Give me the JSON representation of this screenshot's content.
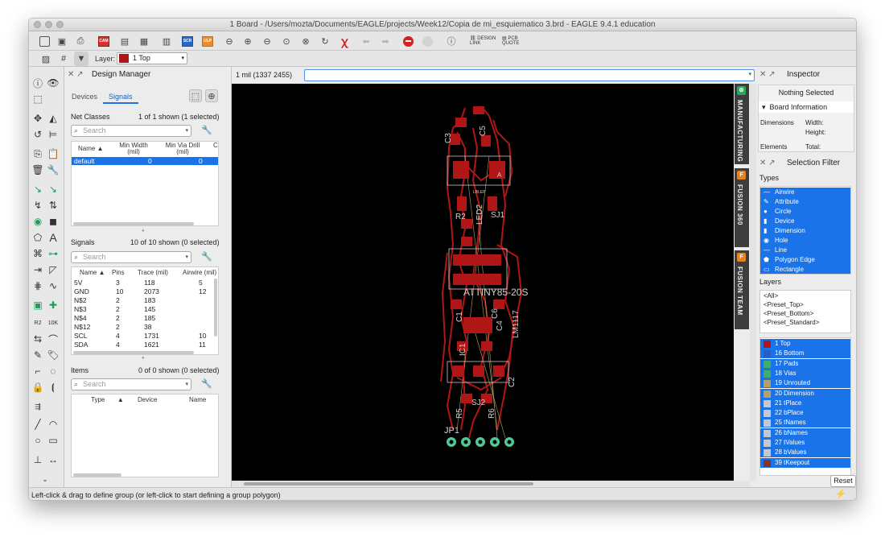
{
  "window": {
    "title": "1 Board - /Users/mozta/Documents/EAGLE/projects/Week12/Copia de mi_esquiematico 3.brd - EAGLE 9.4.1 education"
  },
  "toolbar": {
    "scr_label": "SCR",
    "ulp_label": "ULP",
    "design_link": "DESIGN LINK",
    "pcb_quote": "PCB QUOTE",
    "icons": [
      "new-file-icon",
      "save-icon",
      "print-icon",
      "cam-icon",
      "board-icon",
      "schematic-icon",
      "library-icon",
      "script-icon",
      "ulp-icon",
      "zoom-fit-icon",
      "zoom-in-icon",
      "zoom-out-icon",
      "zoom-select-icon",
      "zoom-area-icon",
      "redraw-icon",
      "ripup-icon",
      "undo-icon",
      "redo-icon",
      "stop-icon",
      "go-icon",
      "help-icon"
    ]
  },
  "layerbar": {
    "label": "Layer:",
    "selected": "1 Top",
    "selected_color": "#b11616"
  },
  "design_manager": {
    "title": "Design Manager",
    "tabs": [
      "Devices",
      "Signals"
    ],
    "active_tab": "Signals",
    "net_classes": {
      "title": "Net Classes",
      "count": "1 of 1 shown (1 selected)",
      "search_placeholder": "Search",
      "headers": [
        "Name",
        "Min Width\n(mil)",
        "Min Via Drill\n(mil)",
        "Cl"
      ],
      "rows": [
        [
          "default",
          "0",
          "0"
        ]
      ]
    },
    "signals": {
      "title": "Signals",
      "count": "10 of 10 shown (0 selected)",
      "search_placeholder": "Search",
      "headers": [
        "Name",
        "Pins",
        "Trace (mil)",
        "Airwire (mil)"
      ],
      "rows": [
        [
          "5V",
          "3",
          "118",
          "5"
        ],
        [
          "GND",
          "10",
          "2073",
          "12"
        ],
        [
          "N$2",
          "2",
          "183",
          ""
        ],
        [
          "N$3",
          "2",
          "145",
          ""
        ],
        [
          "N$4",
          "2",
          "185",
          ""
        ],
        [
          "N$12",
          "2",
          "38",
          ""
        ],
        [
          "SCL",
          "4",
          "1731",
          "10"
        ],
        [
          "SDA",
          "4",
          "1621",
          "11"
        ]
      ]
    },
    "items": {
      "title": "Items",
      "count": "0 of 0 shown (0 selected)",
      "search_placeholder": "Search",
      "headers": [
        "Type",
        "Device",
        "Name"
      ]
    }
  },
  "command": {
    "coordinates": "1 mil (1337 2455)",
    "value": ""
  },
  "side_tabs": [
    "MANUFACTURING",
    "FUSION 360",
    "FUSION TEAM"
  ],
  "board": {
    "labels": [
      "C3",
      "C5",
      "R2",
      "LED2",
      "SJ1",
      "ATTINY85-20S",
      "C1",
      "C6",
      "C4",
      "IC1",
      "LM1117",
      "C2",
      "SJ2",
      "R5",
      "R6",
      "JP1",
      "A",
      "LBLEP"
    ],
    "colors": {
      "background": "#000000",
      "copper_top": "#b11616",
      "pads": "#4fc896",
      "text": "#d0d0d0"
    }
  },
  "inspector": {
    "title": "Inspector",
    "nothing_selected": "Nothing Selected",
    "board_information": "Board Information",
    "dimensions_label": "Dimensions",
    "width_label": "Width:",
    "height_label": "Height:",
    "elements_label": "Elements",
    "total_label": "Total:"
  },
  "selection_filter": {
    "title": "Selection Filter",
    "types_label": "Types",
    "types": [
      "Airwire",
      "Attribute",
      "Circle",
      "Device",
      "Dimension",
      "Hole",
      "Line",
      "Polygon Edge",
      "Rectangle"
    ],
    "layers_label": "Layers",
    "presets": [
      "<All>",
      "<Preset_Top>",
      "<Preset_Bottom>",
      "<Preset_Standard>"
    ],
    "layers": [
      {
        "name": "1 Top",
        "color": "#b11616"
      },
      {
        "name": "16 Bottom",
        "color": "#2a5dbf"
      },
      {
        "name": "17 Pads",
        "color": "#3fae67"
      },
      {
        "name": "18 Vias",
        "color": "#3fae67"
      },
      {
        "name": "19 Unrouted",
        "color": "#b9a15a"
      },
      {
        "name": "20 Dimension",
        "color": "#b9a15a"
      },
      {
        "name": "21 tPlace",
        "color": "#c8c8c8"
      },
      {
        "name": "22 bPlace",
        "color": "#c8c8c8"
      },
      {
        "name": "25 tNames",
        "color": "#c8c8c8"
      },
      {
        "name": "26 bNames",
        "color": "#c8c8c8"
      },
      {
        "name": "27 tValues",
        "color": "#c8c8c8"
      },
      {
        "name": "28 bValues",
        "color": "#c8c8c8"
      },
      {
        "name": "39 tKeepout",
        "color": "#8a3030"
      }
    ],
    "reset_label": "Reset"
  },
  "status": {
    "text": "Left-click & drag to define group (or left-click to start defining a group polygon)"
  }
}
